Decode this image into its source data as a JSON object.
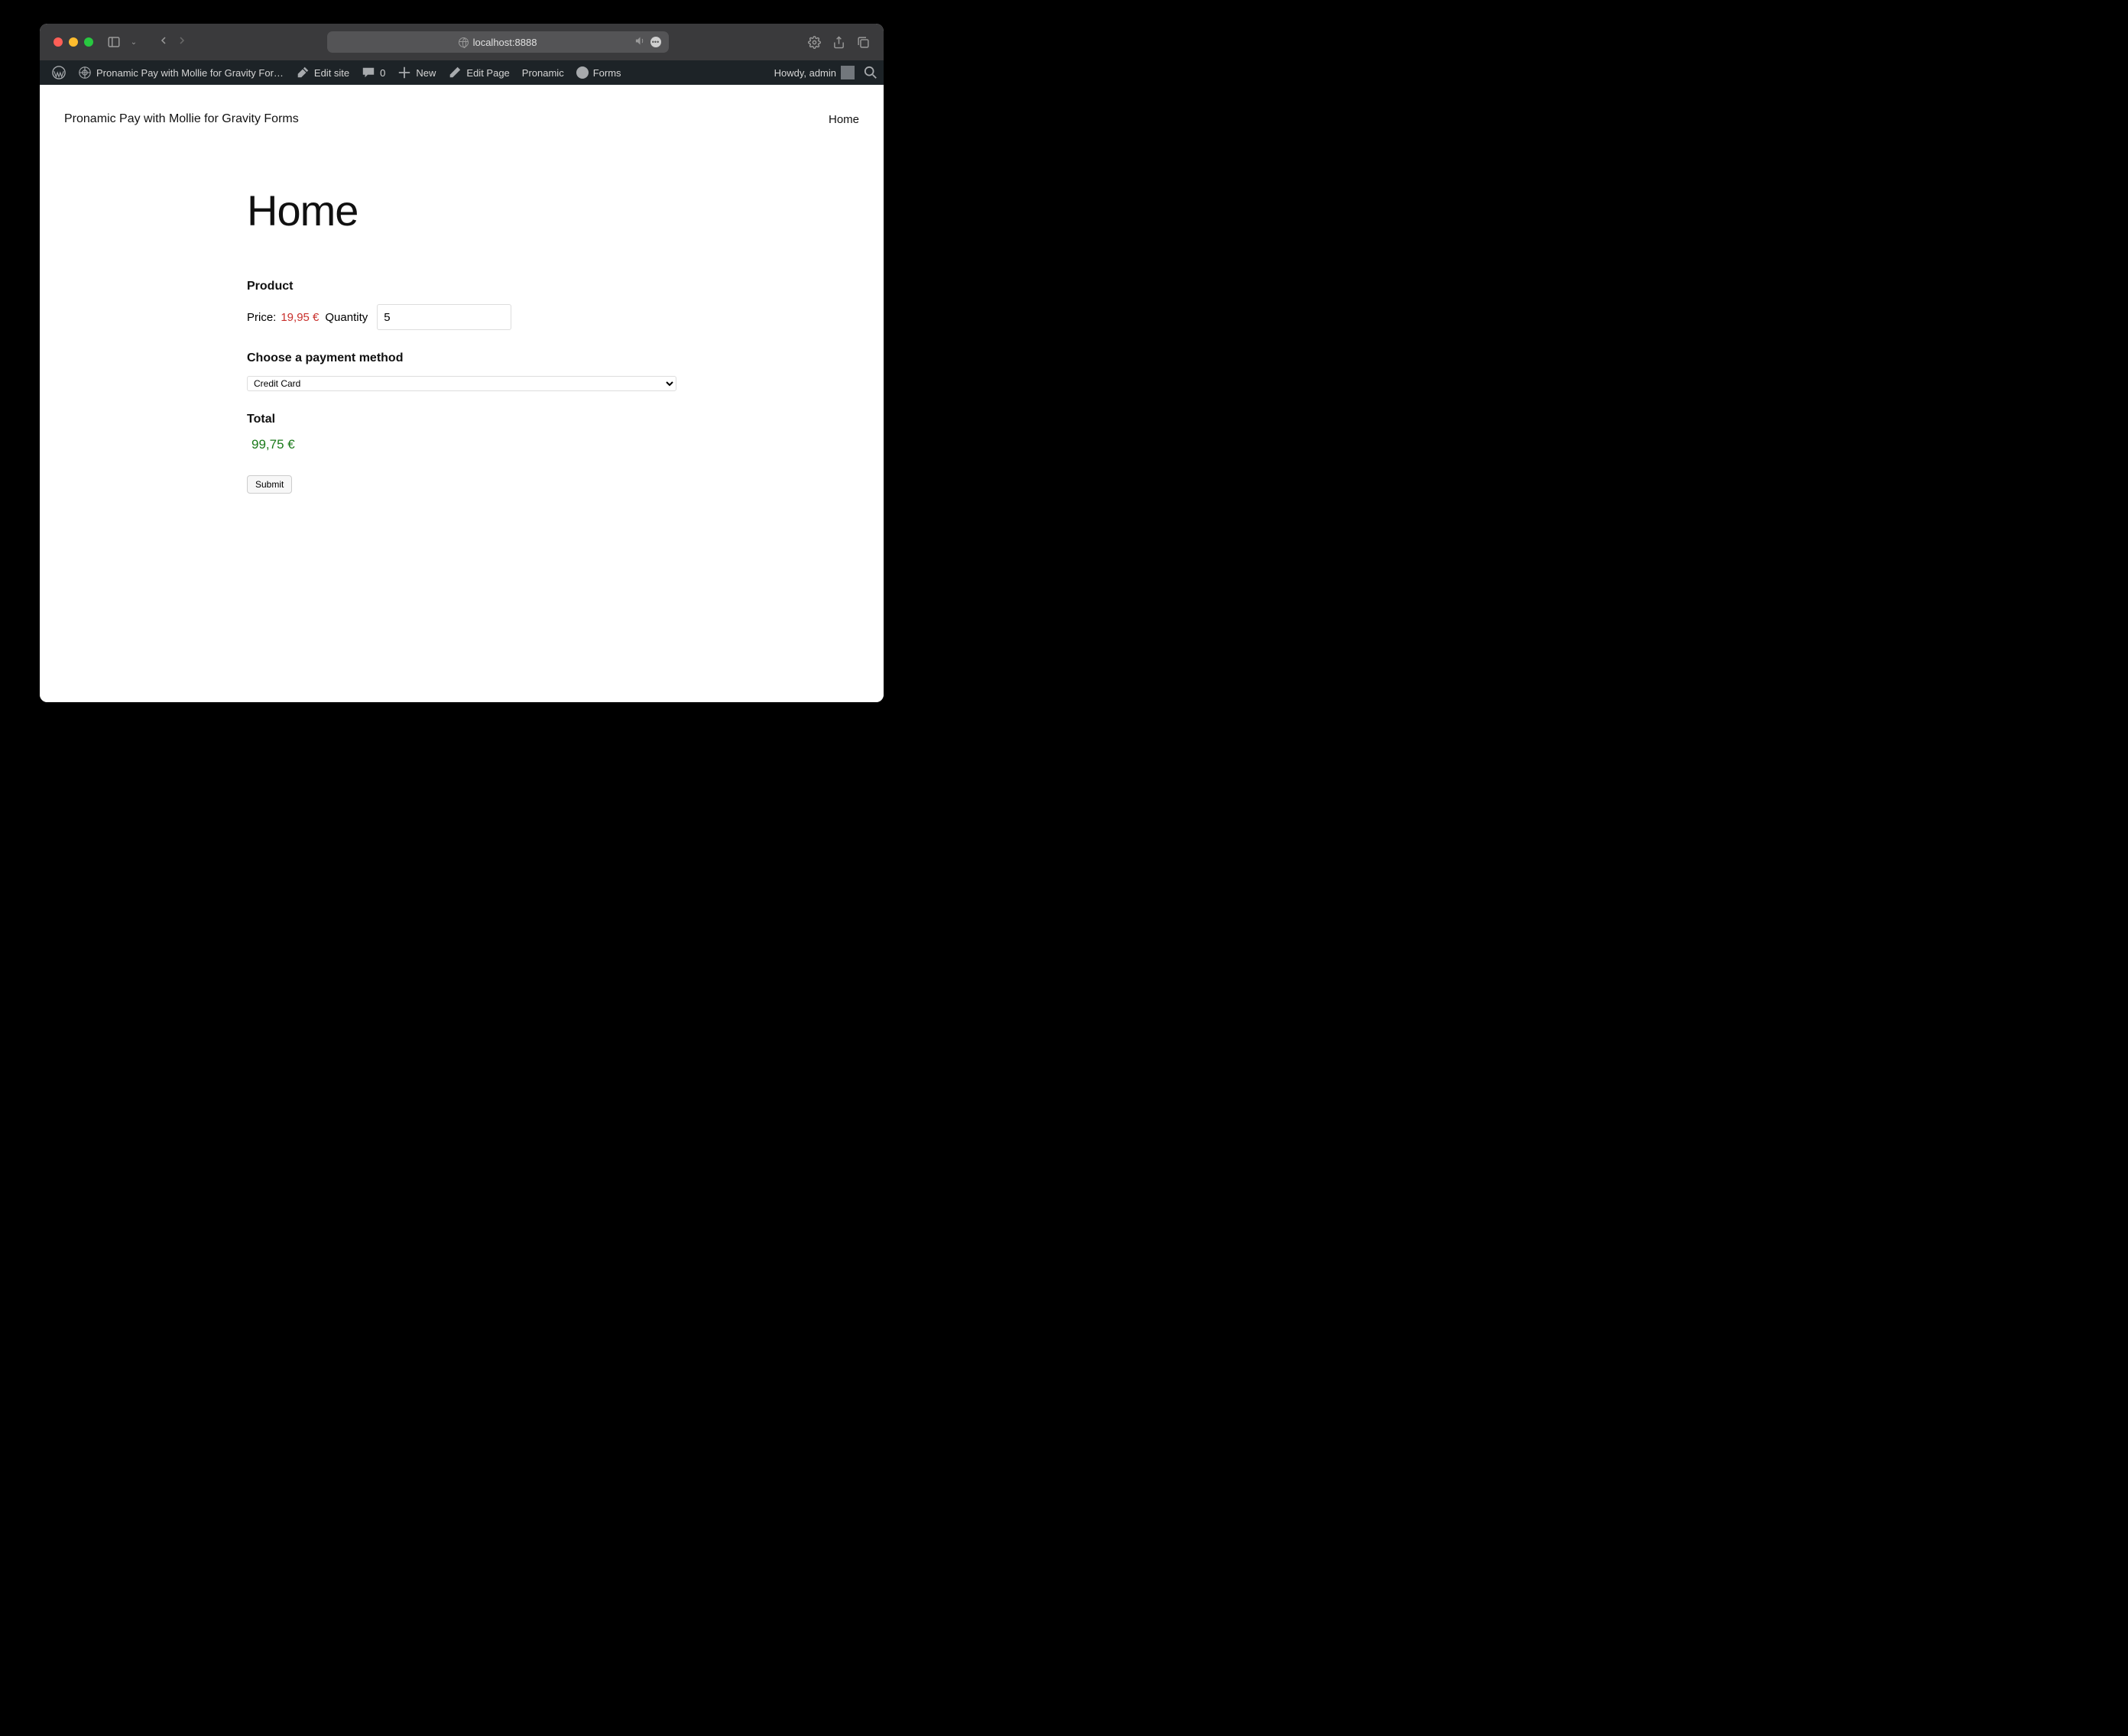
{
  "browser": {
    "url": "localhost:8888"
  },
  "wp_admin_bar": {
    "site_name": "Pronamic Pay with Mollie for Gravity For…",
    "edit_site": "Edit site",
    "comments": "0",
    "new": "New",
    "edit_page": "Edit Page",
    "pronamic": "Pronamic",
    "forms": "Forms",
    "howdy": "Howdy, admin"
  },
  "site_header": {
    "title": "Pronamic Pay with Mollie for Gravity Forms",
    "nav_home": "Home"
  },
  "page": {
    "title": "Home"
  },
  "form": {
    "product_label": "Product",
    "price_label": "Price:",
    "price_value": "19,95 €",
    "quantity_label": "Quantity",
    "quantity_value": "5",
    "payment_method_label": "Choose a payment method",
    "payment_method_value": "Credit Card",
    "total_label": "Total",
    "total_value": "99,75 €",
    "submit_label": "Submit"
  }
}
